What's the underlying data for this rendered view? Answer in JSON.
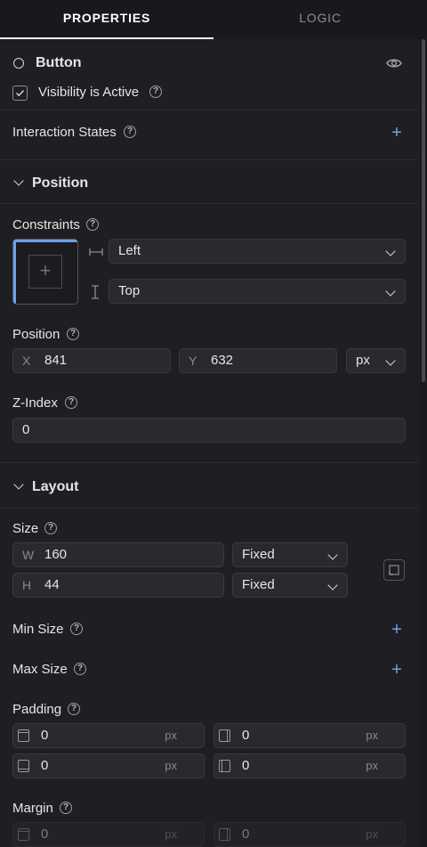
{
  "tabs": {
    "properties": "PROPERTIES",
    "logic": "LOGIC"
  },
  "component": {
    "name": "Button",
    "visibility_label": "Visibility is Active",
    "visibility_checked": true
  },
  "interaction": {
    "label": "Interaction States"
  },
  "sections": {
    "position": "Position",
    "layout": "Layout"
  },
  "constraints": {
    "label": "Constraints",
    "horizontal": "Left",
    "vertical": "Top"
  },
  "position": {
    "label": "Position",
    "x_label": "X",
    "x": "841",
    "y_label": "Y",
    "y": "632",
    "unit": "px"
  },
  "zindex": {
    "label": "Z-Index",
    "value": "0"
  },
  "size": {
    "label": "Size",
    "w_label": "W",
    "w": "160",
    "w_mode": "Fixed",
    "h_label": "H",
    "h": "44",
    "h_mode": "Fixed"
  },
  "min_size": {
    "label": "Min Size"
  },
  "max_size": {
    "label": "Max Size"
  },
  "padding": {
    "label": "Padding",
    "top": "0",
    "right": "0",
    "bottom": "0",
    "left": "0",
    "unit": "px"
  },
  "margin": {
    "label": "Margin",
    "top": "0",
    "right": "0",
    "unit": "px"
  },
  "help_glyph": "?",
  "colors": {
    "accent": "#6aa2e8",
    "background": "#1f1e23",
    "field": "#2a292f"
  }
}
